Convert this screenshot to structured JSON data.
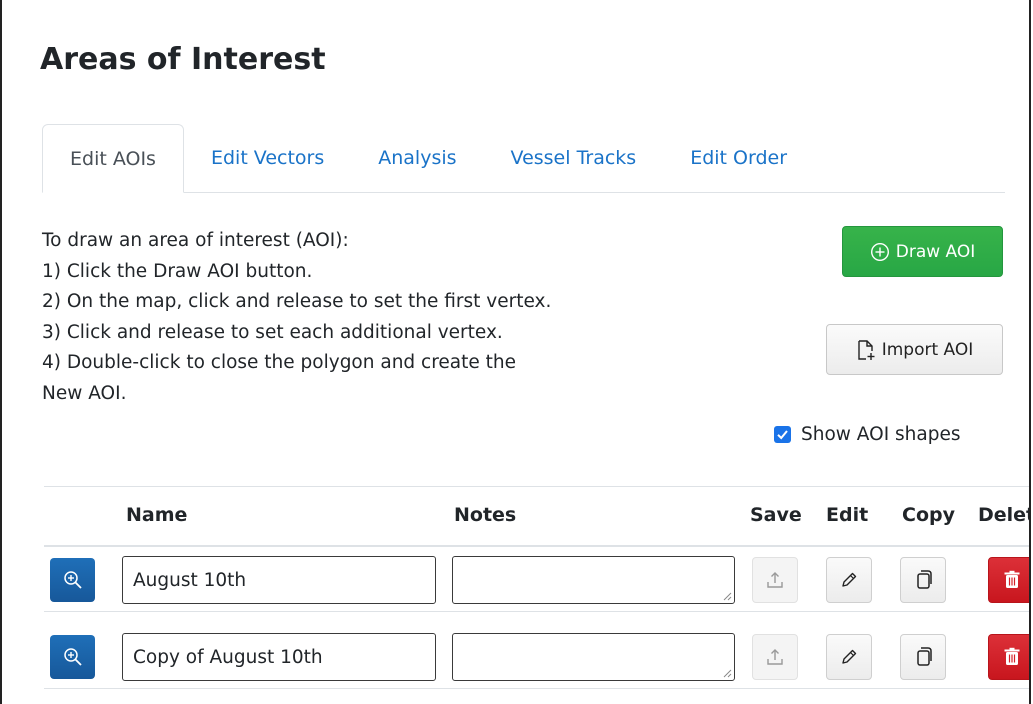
{
  "page": {
    "title": "Areas of Interest"
  },
  "tabs": [
    {
      "label": "Edit AOIs",
      "active": true
    },
    {
      "label": "Edit Vectors",
      "active": false
    },
    {
      "label": "Analysis",
      "active": false
    },
    {
      "label": "Vessel Tracks",
      "active": false
    },
    {
      "label": "Edit Order",
      "active": false
    }
  ],
  "instructions": {
    "lines": [
      "To draw an area of interest (AOI):",
      "1) Click the Draw AOI button.",
      "2) On the map, click and release to set the first vertex.",
      "3) Click and release to set each additional vertex.",
      "4) Double-click to close the polygon and create the",
      "New AOI."
    ]
  },
  "actions": {
    "draw_label": "Draw AOI",
    "import_label": "Import AOI",
    "show_shapes_label": "Show AOI shapes",
    "show_shapes_checked": true
  },
  "table": {
    "headers": {
      "name": "Name",
      "notes": "Notes",
      "save": "Save",
      "edit": "Edit",
      "copy": "Copy",
      "delete": "Delete"
    },
    "rows": [
      {
        "name": "August 10th",
        "notes": ""
      },
      {
        "name": "Copy of August 10th",
        "notes": ""
      }
    ]
  },
  "colors": {
    "link": "#1a73c8",
    "draw_button": "#28a745",
    "zoom_button": "#1a5fa8",
    "delete_button": "#d42027",
    "checkbox": "#1a73e8"
  },
  "icons": {
    "draw": "circle-plus-icon",
    "import": "file-import-icon",
    "zoom": "zoom-in-icon",
    "save": "upload-icon",
    "edit": "pencil-icon",
    "copy": "copy-icon",
    "delete": "trash-icon"
  }
}
